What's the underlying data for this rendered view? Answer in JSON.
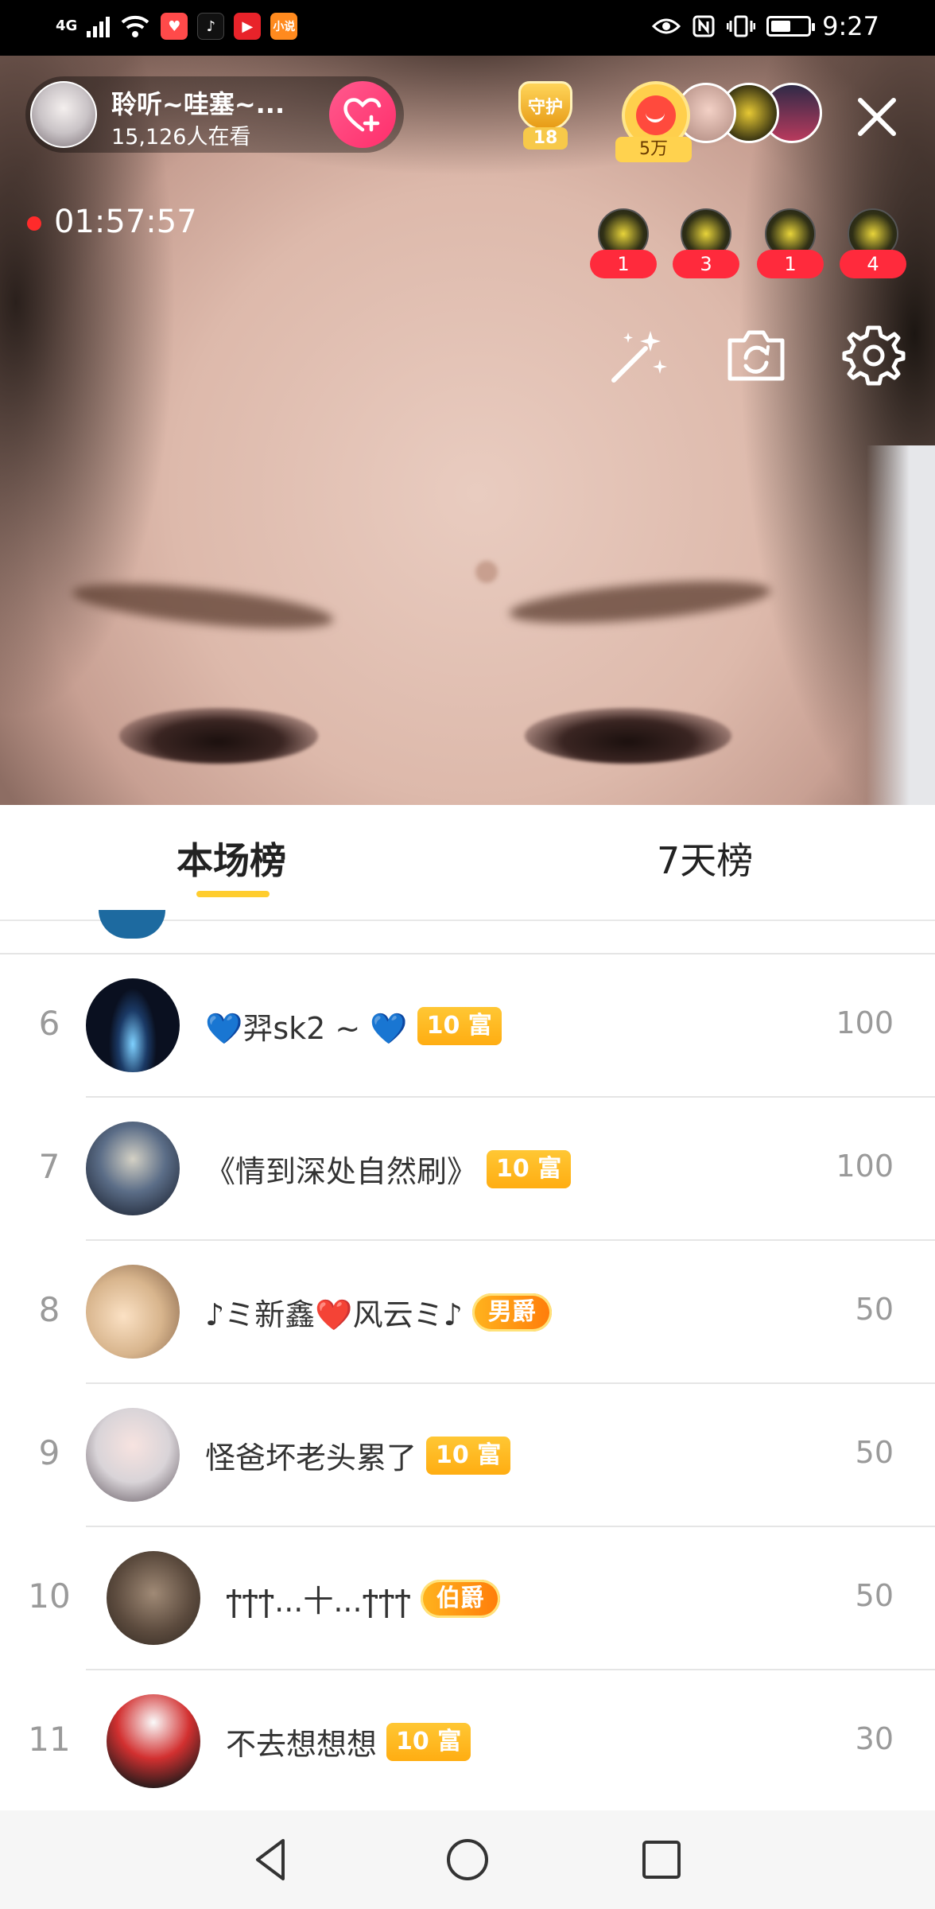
{
  "status_bar": {
    "network_label": "4G",
    "time": "9:27",
    "apps": [
      {
        "icon": "app-icon-red",
        "color": "#ff4a4a"
      },
      {
        "icon": "tiktok-icon",
        "color": "#111111"
      },
      {
        "icon": "video-app-icon",
        "color": "#e8232a"
      },
      {
        "icon": "mini-app-icon",
        "color": "#ff8a1e",
        "label": "小说"
      }
    ]
  },
  "host": {
    "name": "聆听~哇塞~...",
    "viewers": "15,126人在看"
  },
  "guard": {
    "label": "守护",
    "count": "18"
  },
  "audience": {
    "top_tag": "5万"
  },
  "live": {
    "elapsed": "01:57:57"
  },
  "medals": [
    {
      "count": "1"
    },
    {
      "count": "3"
    },
    {
      "count": "1"
    },
    {
      "count": "4"
    }
  ],
  "tabs": [
    {
      "label": "本场榜",
      "active": true
    },
    {
      "label": "7天榜",
      "active": false
    }
  ],
  "ranking": [
    {
      "rank": "6",
      "name": "💙羿sk2 ~ 💙",
      "badge": "10 富",
      "badge_type": "level",
      "score": "100"
    },
    {
      "rank": "7",
      "name": "《情到深处自然刷》",
      "badge": "10 富",
      "badge_type": "level",
      "score": "100"
    },
    {
      "rank": "8",
      "name": "♪ミ新鑫❤️风云ミ♪",
      "badge": "男爵",
      "badge_type": "noble",
      "score": "50"
    },
    {
      "rank": "9",
      "name": "怪爸坏老头累了",
      "badge": "10 富",
      "badge_type": "level",
      "score": "50"
    },
    {
      "rank": "10",
      "name": "ϯϯϯ...十...ϯϯϯ",
      "badge": "伯爵",
      "badge_type": "noble",
      "score": "50"
    },
    {
      "rank": "11",
      "name": "不去想想想",
      "badge": "10 富",
      "badge_type": "level",
      "score": "30"
    }
  ],
  "colors": {
    "accent_yellow": "#ffcd2e",
    "badge_orange": "#ffad12",
    "follow_pink": "#ff2e6b",
    "live_red": "#ff2b2b"
  }
}
